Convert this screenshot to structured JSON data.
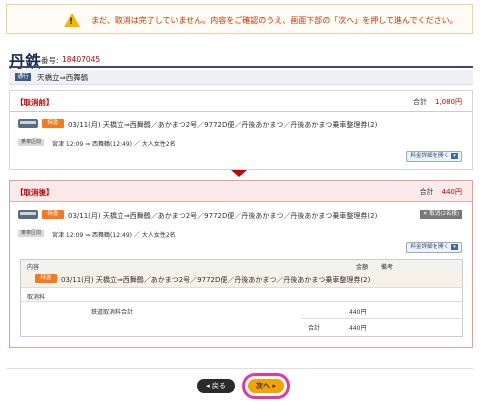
{
  "warning": {
    "icon": "warning-icon",
    "message": "まだ、取消は完了していません。内容をご確認のうえ、画面下部の「次へ」を押して進んでください。"
  },
  "header": {
    "logo": "丹鉄",
    "number_label": "番号:",
    "number_value": "18407045"
  },
  "route": {
    "badge": "通行",
    "text": "天橋立⇒西舞鶴"
  },
  "before": {
    "label": "【取消前】",
    "total_label": "合計",
    "total_value": "1,080円",
    "limited_tag": "特急",
    "itinerary": "03/11(月) 天橋立⇒西舞鶴／あかまつ2号／9772D便／丹後あかまつ／丹後あかまつ乗車整理券(2)",
    "section_tag": "乗車区間",
    "sub_text": "宮津 12:09 ⇒ 西舞鶴(12:49) ／ 大人女性2名",
    "detail_button": "料金詳細を開く"
  },
  "after": {
    "label": "【取消後】",
    "total_label": "合計",
    "total_value": "440円",
    "limited_tag": "特急",
    "itinerary": "03/11(月) 天橋立⇒西舞鶴／あかまつ2号／9772D便／丹後あかまつ／丹後あかまつ乗車整理券(2)",
    "cancel_tag": "✕ 取消(2名様)",
    "section_tag": "乗車区間",
    "sub_text": "宮津 12:09 ⇒ 西舞鶴(12:49) ／ 大人女性2名",
    "detail_button": "料金詳細を開く",
    "table": {
      "headers": [
        "内容",
        "金額",
        "備考"
      ],
      "item_tag": "特急",
      "item_text": "03/11(月) 天橋立⇒西舞鶴／あかまつ2号／9772D便／丹後あかまつ／丹後あかまつ乗車整理券(2)",
      "fee_heading": "取消料",
      "fee_label": "鉄道取消料合計",
      "fee_value": "440円",
      "sum_label": "合計",
      "sum_value": "440円"
    }
  },
  "buttons": {
    "back": "◂ 戻る",
    "next": "次へ ▸"
  },
  "colors": {
    "accent_red": "#c00000",
    "limited_orange": "#f47a20",
    "next_orange": "#f5a300",
    "highlight_pink": "#e8379c"
  }
}
